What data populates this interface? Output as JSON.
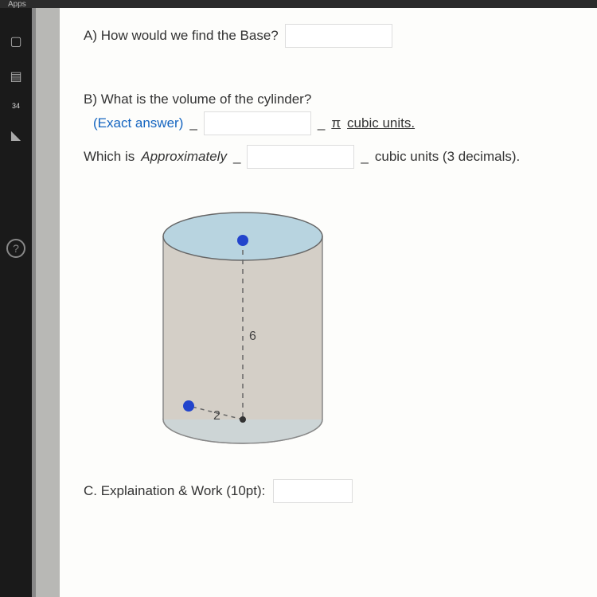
{
  "browser": {
    "apps_label": "Apps"
  },
  "sidebar": {
    "badge_number": "34",
    "help_symbol": "?"
  },
  "questions": {
    "a": {
      "text": "A) How would we find the Base?"
    },
    "b": {
      "text": "B) What is the volume of the cylinder?",
      "exact_label": "(Exact answer)",
      "pi_text": "π",
      "cubic_units_text": "cubic units.",
      "approx_prefix": "Which is",
      "approx_label": "Approximately",
      "approx_suffix": "cubic units (3 decimals)."
    },
    "c": {
      "text": "C. Explaination & Work (10pt):"
    }
  },
  "chart_data": {
    "type": "diagram",
    "shape": "cylinder",
    "height_label": "6",
    "radius_label": "2",
    "height_value": 6,
    "radius_value": 2
  }
}
